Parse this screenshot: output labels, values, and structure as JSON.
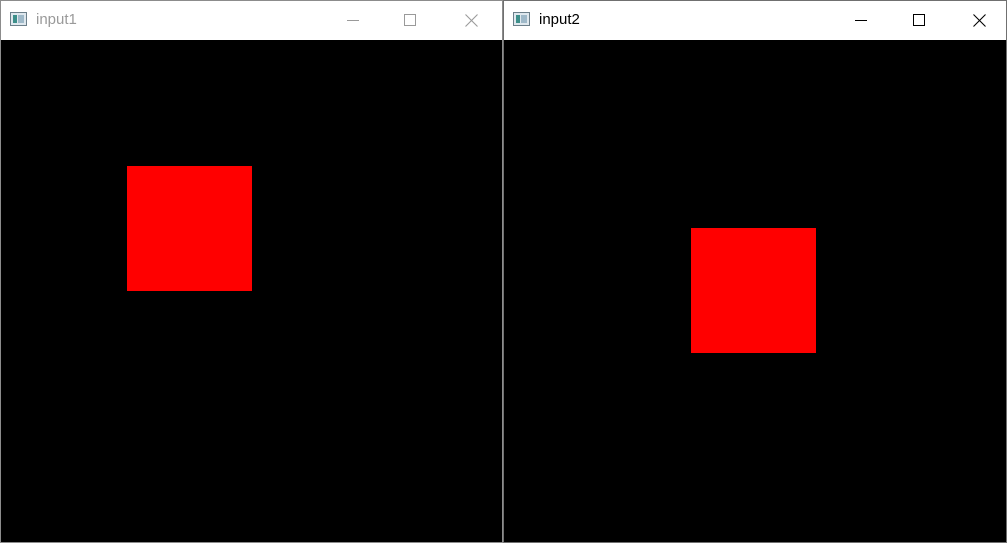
{
  "windows": [
    {
      "title": "input1",
      "active": false,
      "controls": {
        "minimize": "minimize-icon",
        "maximize": "maximize-icon",
        "close": "close-icon"
      },
      "canvas": {
        "background": "#000000",
        "shape": "square",
        "shape_color": "#ff0000"
      }
    },
    {
      "title": "input2",
      "active": true,
      "controls": {
        "minimize": "minimize-icon",
        "maximize": "maximize-icon",
        "close": "close-icon"
      },
      "canvas": {
        "background": "#000000",
        "shape": "square",
        "shape_color": "#ff0000"
      }
    }
  ]
}
